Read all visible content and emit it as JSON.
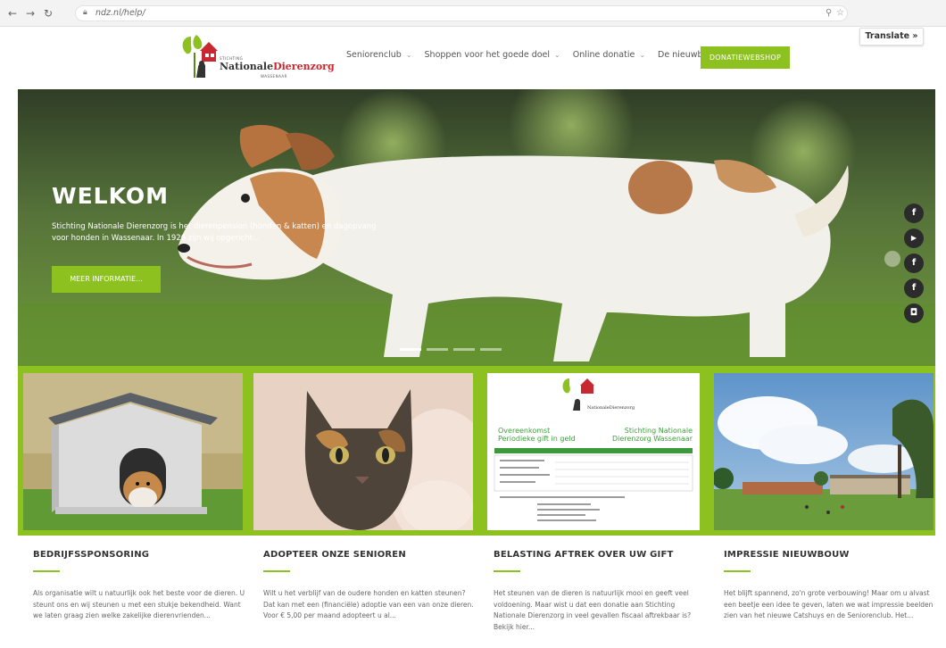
{
  "browser": {
    "url": "ndz.nl/help/"
  },
  "logo": {
    "top_small": "STICHTING",
    "name_part1": "Nationale",
    "name_part2": "Dierenzorg",
    "bottom_small": "WASSENAAR"
  },
  "menu": [
    {
      "label": "Seniorenclub",
      "has_dropdown": true
    },
    {
      "label": "Shoppen voor het goede doel",
      "has_dropdown": true
    },
    {
      "label": "Online donatie",
      "has_dropdown": true
    },
    {
      "label": "De nieuwbouw",
      "has_dropdown": false
    }
  ],
  "shop_button": "DONATIEWEBSHOP",
  "translate": "Translate »",
  "hero": {
    "title": "WELKOM",
    "text": "Stichting Nationale Dierenzorg is het dierenpension (honden & katten) en dagopvang voor honden in Wassenaar. In 1926 zijn wij opgericht...",
    "button": "MEER INFORMATIE..."
  },
  "social": [
    "f",
    "▶",
    "f",
    "f",
    "◘"
  ],
  "form_tile": {
    "left_title_1": "Overeenkomst",
    "left_title_2": "Periodieke gift in geld",
    "right_title_1": "Stichting Nationale",
    "right_title_2": "Dierenzorg Wassenaar"
  },
  "columns": [
    {
      "title": "BEDRIJFSSPONSORING",
      "text": "Als organisatie wilt u natuurlijk ook het beste voor de dieren. U steunt ons en wij steunen u met een stukje bekendheid. Want we laten graag zien welke zakelijke dierenvrienden..."
    },
    {
      "title": "ADOPTEER ONZE SENIOREN",
      "text": "Wilt u het verblijf van de oudere honden en katten steunen? Dat kan met een (financiële) adoptie van een van onze dieren.  Voor € 5,00 per maand adopteert u al..."
    },
    {
      "title": "BELASTING AFTREK OVER UW GIFT",
      "text": "Het steunen van de dieren is natuurlijk mooi en geeft veel voldoening. Maar wist u dat een donatie aan Stichting Nationale Dierenzorg in veel gevallen fiscaal aftrekbaar is? Bekijk hier..."
    },
    {
      "title": "IMPRESSIE NIEUWBOUW",
      "text": "Het blijft spannend, zo'n grote verbouwing! Maar om u alvast een beetje een idee te geven, laten we wat impressie beelden zien van het nieuwe Catshuys en de Seniorenclub. Het..."
    }
  ],
  "colors": {
    "accent": "#8cc11f",
    "logo_red": "#c8282f"
  }
}
